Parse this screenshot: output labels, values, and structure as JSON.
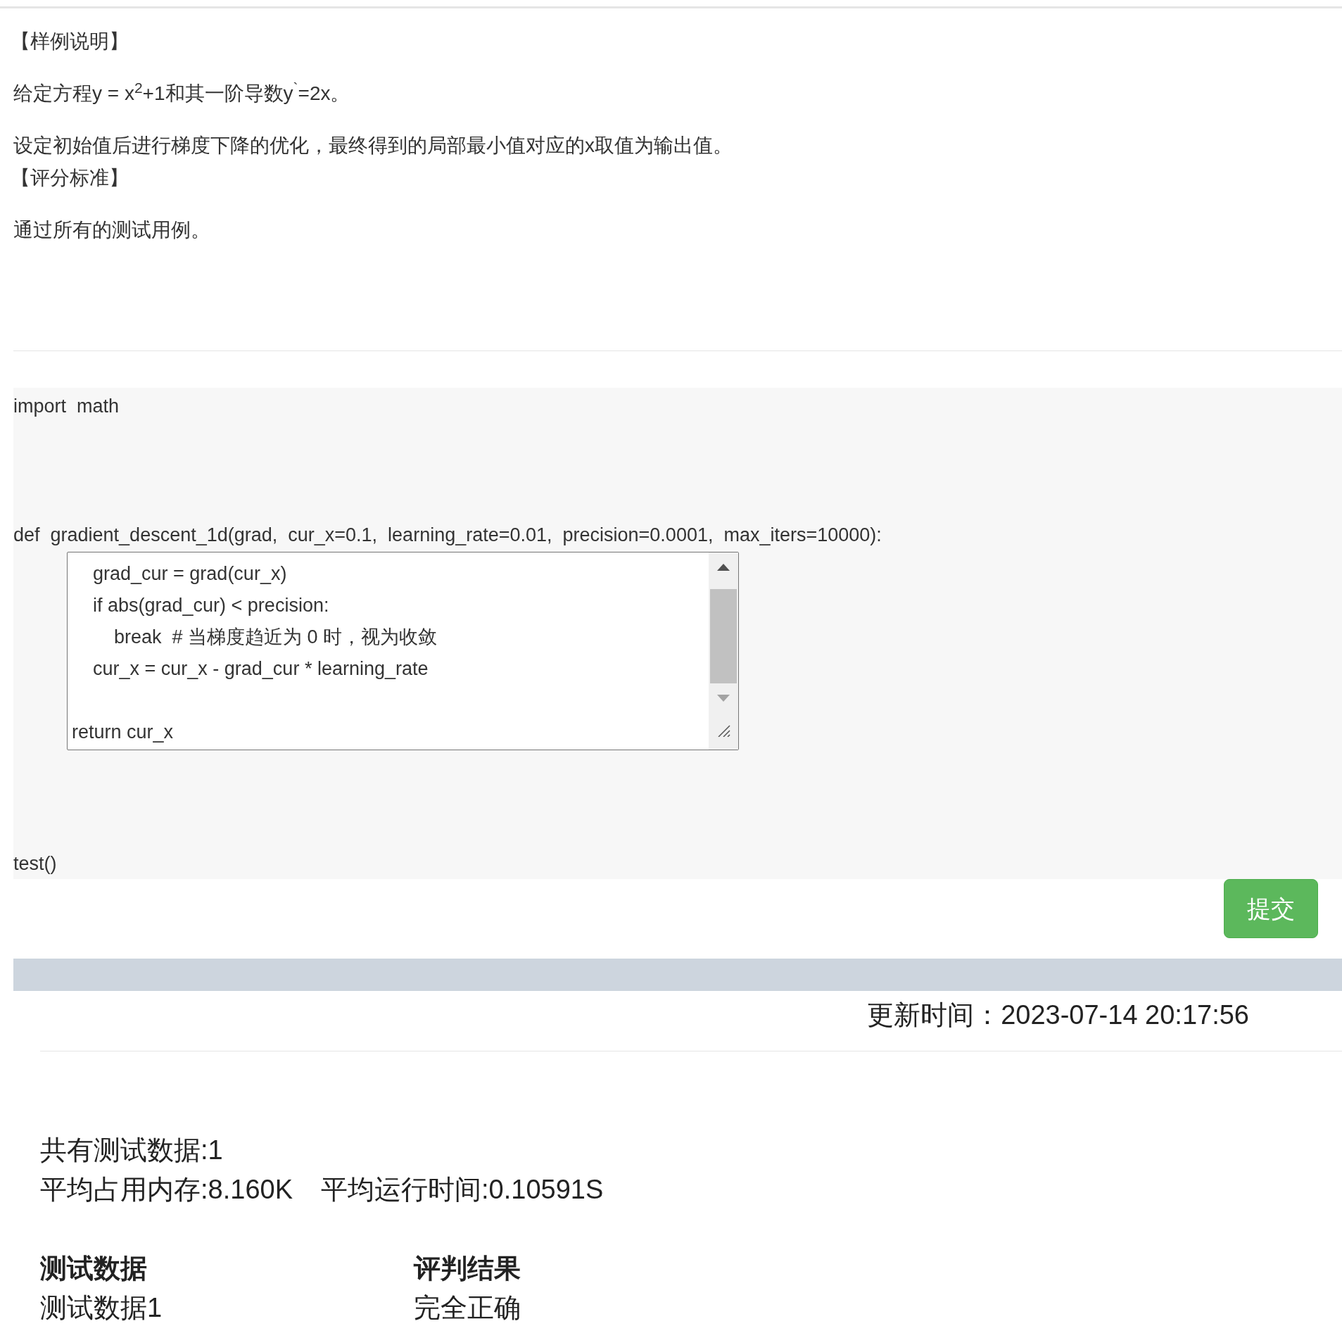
{
  "description": [
    {
      "kind": "heading",
      "text": "【样例说明】"
    },
    {
      "kind": "paragraph",
      "text": "给定方程y = x$^{2}$+1和其一阶导数y$^{`}$=2x。"
    },
    {
      "kind": "paragraph",
      "text": "设定初始值后进行梯度下降的优化，最终得到的局部最小值对应的x取值为输出值。"
    },
    {
      "kind": "heading",
      "text": "【评分标准】"
    },
    {
      "kind": "paragraph",
      "text": "通过所有的测试用例。"
    }
  ],
  "code": {
    "import_line": "import  math",
    "def_line": "def  gradient_descent_1d(grad,  cur_x=0.1,  learning_rate=0.01,  precision=0.0001,  max_iters=10000):",
    "editor_text": "    grad_cur = grad(cur_x)\n    if abs(grad_cur) < precision:\n        break  # 当梯度趋近为 0 时，视为收敛\n    cur_x = cur_x - grad_cur * learning_rate\n\nreturn cur_x",
    "test_line": "test()"
  },
  "submit_button": "提交",
  "update_time": "更新时间：2023-07-14 20:17:56",
  "summary": {
    "total": "共有测试数据:1",
    "memory": "平均占用内存:8.160K",
    "runtime": "平均运行时间:0.10591S"
  },
  "results": {
    "columns": [
      "测试数据",
      "评判结果"
    ],
    "rows": [
      [
        "测试数据1",
        "完全正确"
      ]
    ]
  }
}
